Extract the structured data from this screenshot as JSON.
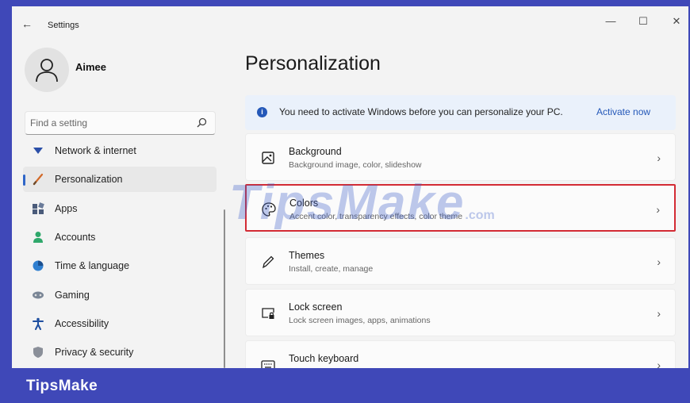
{
  "window": {
    "title": "Settings",
    "back_glyph": "←",
    "minimize_glyph": "—",
    "maximize_glyph": "☐",
    "close_glyph": "✕"
  },
  "profile": {
    "name": "Aimee"
  },
  "search": {
    "placeholder": "Find a setting"
  },
  "sidebar": {
    "items": [
      {
        "label": "Network & internet",
        "icon": "wifi-icon",
        "active": false
      },
      {
        "label": "Personalization",
        "icon": "brush-icon",
        "active": true
      },
      {
        "label": "Apps",
        "icon": "apps-icon",
        "active": false
      },
      {
        "label": "Accounts",
        "icon": "accounts-icon",
        "active": false
      },
      {
        "label": "Time & language",
        "icon": "globe-clock-icon",
        "active": false
      },
      {
        "label": "Gaming",
        "icon": "gamepad-icon",
        "active": false
      },
      {
        "label": "Accessibility",
        "icon": "accessibility-icon",
        "active": false
      },
      {
        "label": "Privacy & security",
        "icon": "shield-icon",
        "active": false
      }
    ]
  },
  "main": {
    "title": "Personalization",
    "banner": {
      "message": "You need to activate Windows before you can personalize your PC.",
      "action": "Activate now"
    },
    "cards": [
      {
        "title": "Background",
        "subtitle": "Background image, color, slideshow",
        "icon": "image-icon",
        "highlighted": false
      },
      {
        "title": "Colors",
        "subtitle": "Accent color, transparency effects, color theme",
        "icon": "palette-icon",
        "highlighted": true
      },
      {
        "title": "Themes",
        "subtitle": "Install, create, manage",
        "icon": "pen-icon",
        "highlighted": false
      },
      {
        "title": "Lock screen",
        "subtitle": "Lock screen images, apps, animations",
        "icon": "lock-screen-icon",
        "highlighted": false
      },
      {
        "title": "Touch keyboard",
        "subtitle": "",
        "icon": "keyboard-icon",
        "highlighted": false
      }
    ]
  },
  "watermark": {
    "text": "TipsMake",
    "suffix": ".com"
  },
  "brand": {
    "text": "TipsMake"
  },
  "colors": {
    "frame": "#3f48b8",
    "accent": "#2458b8",
    "highlight": "#d32b34",
    "window_bg": "#f3f3f3"
  }
}
